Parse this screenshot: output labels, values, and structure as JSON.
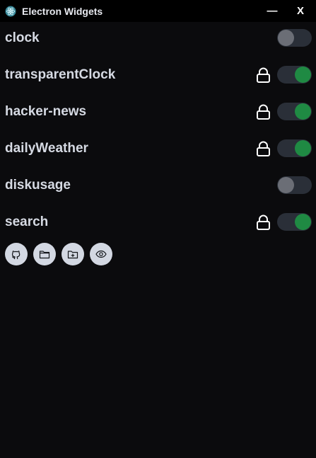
{
  "window": {
    "title": "Electron Widgets",
    "minimize_label": "—",
    "close_label": "X",
    "app_icon": "electron-atom-icon"
  },
  "widgets": [
    {
      "name": "clock",
      "enabled": false,
      "locked": false
    },
    {
      "name": "transparentClock",
      "enabled": true,
      "locked": true
    },
    {
      "name": "hacker-news",
      "enabled": true,
      "locked": true
    },
    {
      "name": "dailyWeather",
      "enabled": true,
      "locked": true
    },
    {
      "name": "diskusage",
      "enabled": false,
      "locked": false
    },
    {
      "name": "search",
      "enabled": true,
      "locked": true
    }
  ],
  "actions": [
    {
      "icon": "github-icon"
    },
    {
      "icon": "folder-icon"
    },
    {
      "icon": "folder-plus-icon"
    },
    {
      "icon": "eye-icon"
    }
  ],
  "colors": {
    "background": "#0b0b0d",
    "titlebar": "#000000",
    "toggle_on": "#1f8a43",
    "toggle_off_knob": "#6b6e76",
    "toggle_track": "#2a2f38",
    "action_button": "#d3d8e2"
  }
}
